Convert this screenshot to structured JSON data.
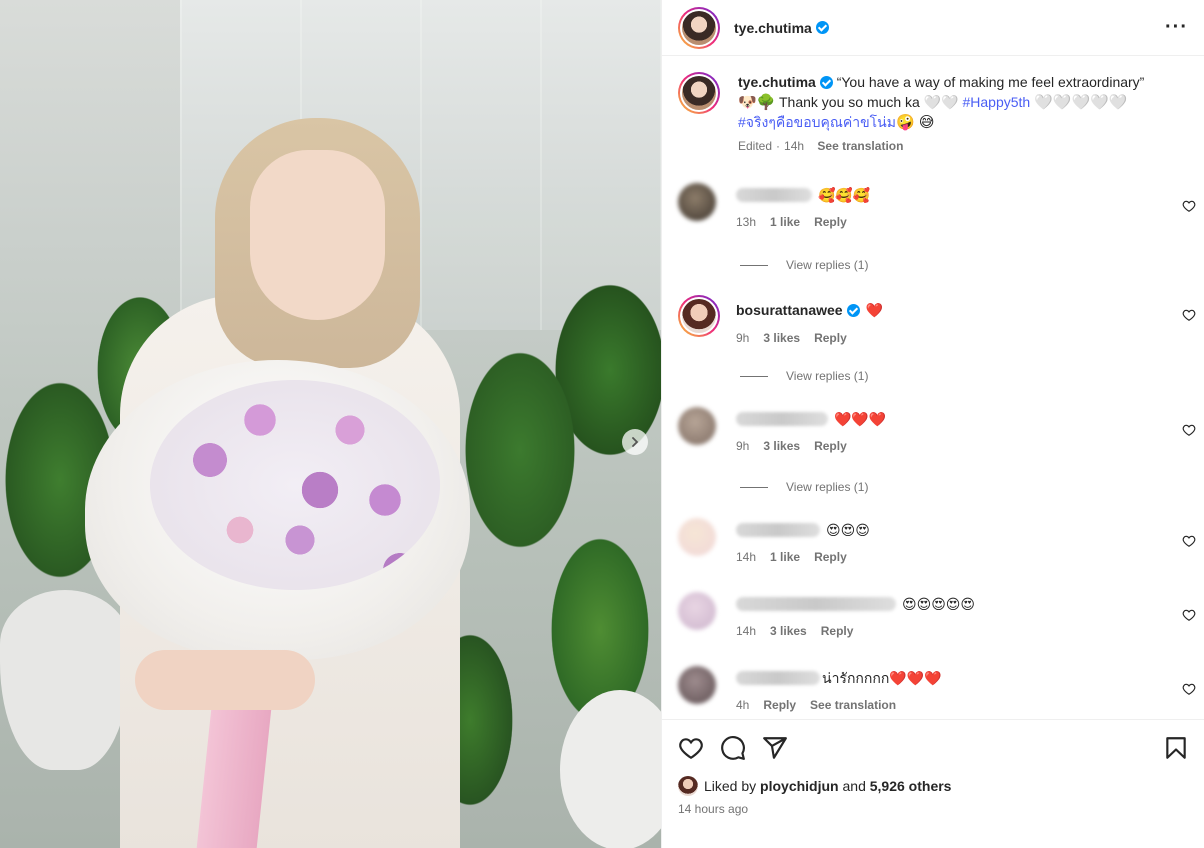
{
  "post_author": {
    "username": "tye.chutima",
    "verified": true
  },
  "caption": {
    "username": "tye.chutima",
    "line1": "“You have a way of making me feel extraordinary”",
    "emoji_prefix": "🐶🌳",
    "line2": "Thank you so much ka 🤍🤍",
    "hashtag1": "#Happy5th",
    "hearts": "🤍🤍🤍🤍🤍",
    "hashtag2": "#จริงๆคือขอบคุณค่าขโน่ม",
    "emoji_suffix": "🤪 😅",
    "edited": "Edited",
    "time": "14h",
    "see_translation": "See translation"
  },
  "comments": [
    {
      "username": "",
      "text": "🥰🥰🥰",
      "time": "13h",
      "likes": "1 like",
      "reply": "Reply",
      "view_replies": "View replies (1)"
    },
    {
      "username": "bosurattanawee",
      "verified": true,
      "text": "❤️",
      "time": "9h",
      "likes": "3 likes",
      "reply": "Reply",
      "view_replies": "View replies (1)"
    },
    {
      "username": "",
      "text": "❤️❤️❤️",
      "time": "9h",
      "likes": "3 likes",
      "reply": "Reply",
      "view_replies": "View replies (1)"
    },
    {
      "username": "",
      "text": "😍😍😍",
      "time": "14h",
      "likes": "1 like",
      "reply": "Reply"
    },
    {
      "username": "",
      "text": "😍😍😍😍😍",
      "time": "14h",
      "likes": "3 likes",
      "reply": "Reply"
    },
    {
      "username": "",
      "text": "น่ารักกกกก❤️❤️❤️",
      "time": "4h",
      "reply": "Reply",
      "see_translation": "See translation"
    }
  ],
  "likes": {
    "prefix": "Liked by",
    "user": "ploychidjun",
    "and": "and",
    "others": "5,926 others"
  },
  "posted": "14 hours ago",
  "icons": [
    "verified-badge",
    "more-options-icon",
    "heart-icon",
    "comment-icon",
    "share-icon",
    "bookmark-icon",
    "chevron-right-icon"
  ]
}
